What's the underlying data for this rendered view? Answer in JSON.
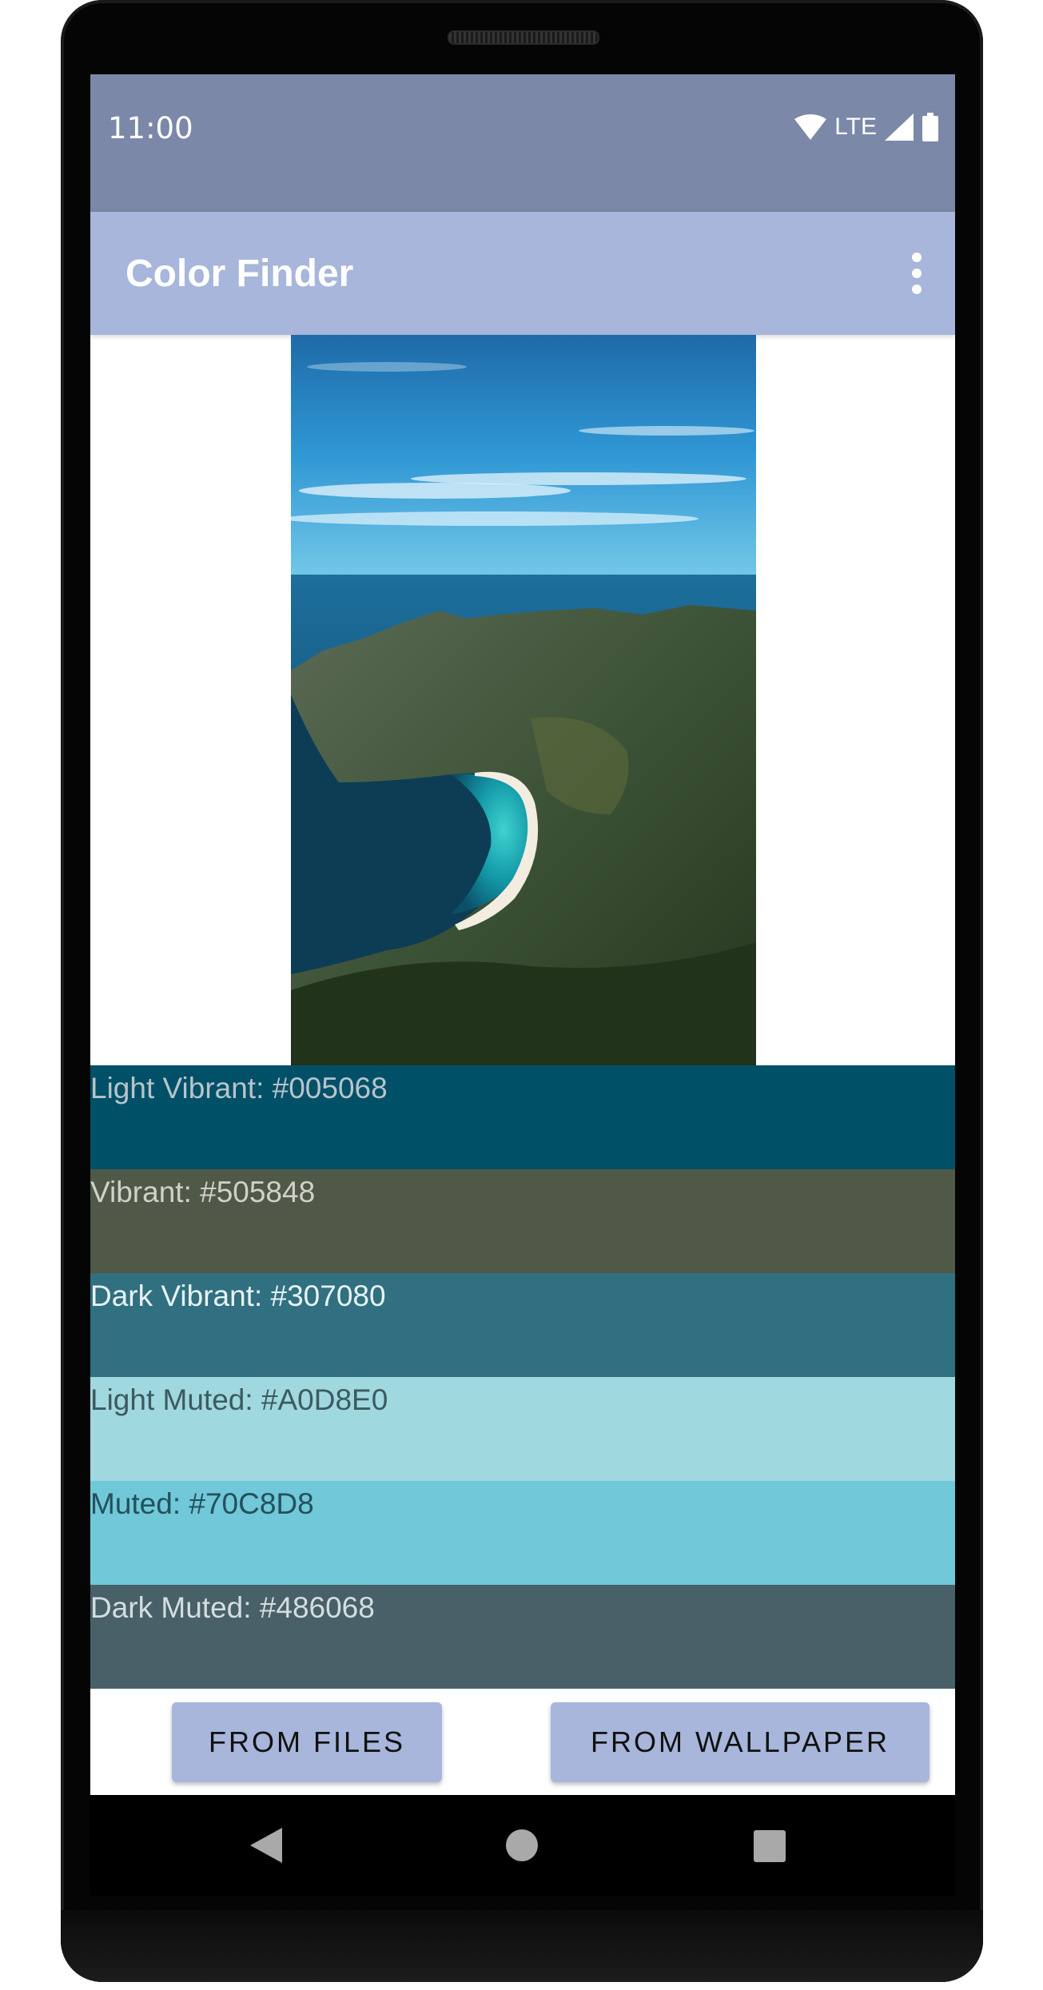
{
  "status_bar": {
    "time": "11:00",
    "network": "LTE",
    "background": "#7b88a8",
    "icons": [
      "wifi-icon",
      "signal-icon",
      "battery-icon"
    ]
  },
  "app_bar": {
    "title": "Color Finder",
    "background": "#a7b6da",
    "menu_icon": "more-vert-icon"
  },
  "palette": [
    {
      "label": "Light Vibrant: #005068",
      "color": "#005068",
      "text_color": "#b8c4ca"
    },
    {
      "label": "Vibrant: #505848",
      "color": "#505848",
      "text_color": "#d0d2ca"
    },
    {
      "label": "Dark Vibrant: #307080",
      "color": "#307080",
      "text_color": "#e8f2f4"
    },
    {
      "label": "Light Muted: #A0D8E0",
      "color": "#A0D8E0",
      "text_color": "#3c5a60"
    },
    {
      "label": "Muted: #70C8D8",
      "color": "#70C8D8",
      "text_color": "#24505c"
    },
    {
      "label": "Dark Muted: #486068",
      "color": "#486068",
      "text_color": "#d4dde0"
    }
  ],
  "buttons": {
    "from_files": "FROM FILES",
    "from_wallpaper": "FROM WALLPAPER"
  },
  "nav_bar": {
    "icons": [
      "back-icon",
      "home-icon",
      "recents-icon"
    ]
  }
}
